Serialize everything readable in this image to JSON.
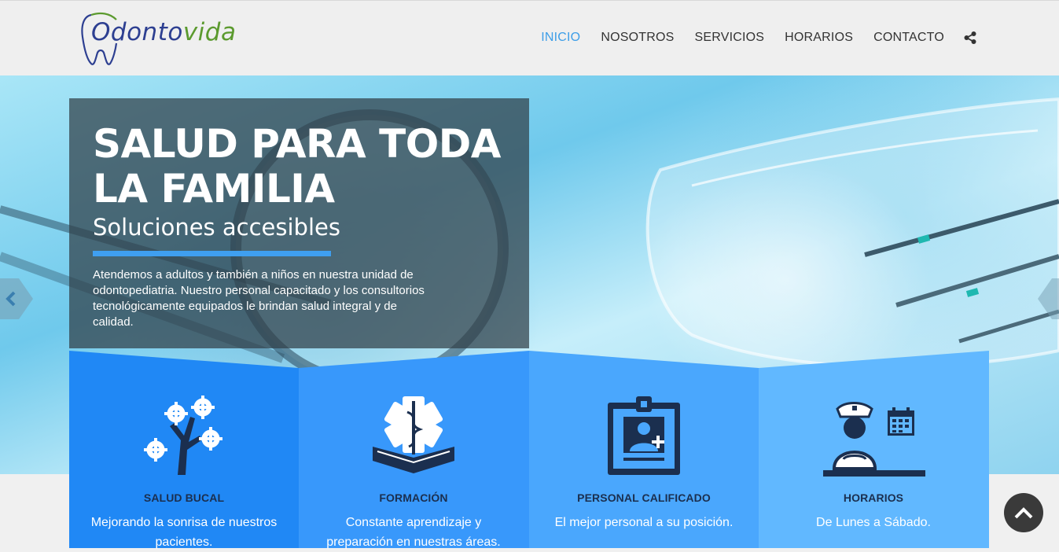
{
  "header": {
    "logo_text_part1": "Odonto",
    "logo_text_part2": "vida"
  },
  "nav": {
    "items": [
      {
        "label": "INICIO",
        "active": true
      },
      {
        "label": "NOSOTROS",
        "active": false
      },
      {
        "label": "SERVICIOS",
        "active": false
      },
      {
        "label": "HORARIOS",
        "active": false
      },
      {
        "label": "CONTACTO",
        "active": false
      }
    ],
    "share_icon": "share-icon"
  },
  "hero": {
    "title": "SALUD PARA TODA LA FAMILIA",
    "subtitle": "Soluciones accesibles",
    "description": "Atendemos a adultos y también a niños en nuestra unidad de odontopediatria. Nuestro personal capacitado y los consultorios tecnológicamente equipados le brindan salud integral y de calidad.",
    "prev_icon": "chevron-left-icon",
    "next_icon": "chevron-right-icon"
  },
  "features": [
    {
      "title": "SALUD BUCAL",
      "description": "Mejorando la sonrisa de nuestros pacientes.",
      "icon": "gear-tree-icon",
      "color": "#2088f5"
    },
    {
      "title": "FORMACIÓN",
      "description": "Constante aprendizaje y preparación en nuestras áreas.",
      "icon": "medical-book-icon",
      "color": "#3898fb"
    },
    {
      "title": "PERSONAL CALIFICADO",
      "description": "El mejor personal a su posición.",
      "icon": "doctor-badge-icon",
      "color": "#4aa7fd"
    },
    {
      "title": "HORARIOS",
      "description": "De Lunes a Sábado.",
      "icon": "nurse-calendar-icon",
      "color": "#61b8ff"
    }
  ],
  "scroll_top_icon": "chevron-up-icon",
  "colors": {
    "accent": "#3d9ee8",
    "brand_blue": "#2d3f91",
    "brand_green": "#5b9a2e",
    "icon_dark": "#1b2f4f"
  }
}
